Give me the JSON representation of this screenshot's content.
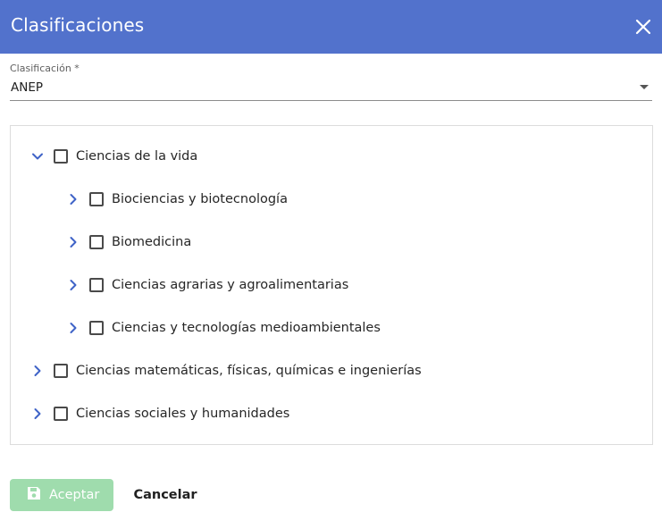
{
  "dialog": {
    "title": "Clasificaciones",
    "close_icon": "close-icon"
  },
  "select": {
    "label": "Clasificación *",
    "value": "ANEP"
  },
  "tree": {
    "nodes": [
      {
        "label": "Ciencias de la vida",
        "expanded": true,
        "level": 0,
        "checked": false
      },
      {
        "label": "Biociencias y biotecnología",
        "expanded": false,
        "level": 1,
        "checked": false
      },
      {
        "label": "Biomedicina",
        "expanded": false,
        "level": 1,
        "checked": false
      },
      {
        "label": "Ciencias agrarias y agroalimentarias",
        "expanded": false,
        "level": 1,
        "checked": false
      },
      {
        "label": "Ciencias y tecnologías medioambientales",
        "expanded": false,
        "level": 1,
        "checked": false
      },
      {
        "label": "Ciencias matemáticas, físicas, químicas e ingenierías",
        "expanded": false,
        "level": 0,
        "checked": false
      },
      {
        "label": "Ciencias sociales y humanidades",
        "expanded": false,
        "level": 0,
        "checked": false
      }
    ]
  },
  "footer": {
    "accept_label": "Aceptar",
    "cancel_label": "Cancelar"
  },
  "colors": {
    "header": "#5272cc",
    "accent_chevron": "#3f63c7",
    "accept_disabled": "#9fdcad"
  }
}
